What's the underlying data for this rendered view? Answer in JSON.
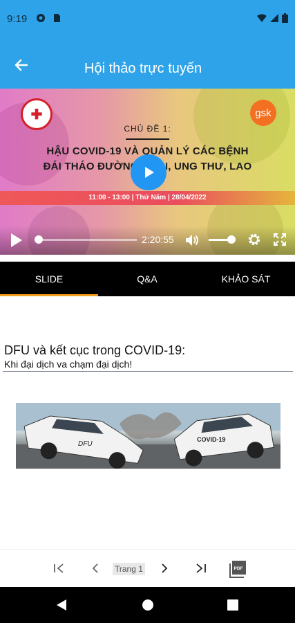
{
  "status_bar": {
    "time": "9:19",
    "icons": [
      "data-saver-icon",
      "sim-card-icon",
      "wifi-icon",
      "signal-icon",
      "battery-icon"
    ]
  },
  "app_bar": {
    "title": "Hội thảo trực tuyến",
    "back_icon": "arrow-back-icon"
  },
  "video": {
    "topic_label": "CHỦ ĐỀ 1:",
    "headline_line1": "HẬU COVID-19 VÀ QUẢN LÝ CÁC BỆNH",
    "headline_line2": "ĐÁI THÁO ĐƯỜNG, GAN, UNG THƯ, LAO",
    "schedule": "11:00 - 13:00 | Thứ Năm | 28/04/2022",
    "sponsor_logo_text": "gsk",
    "elapsed_time": "2:20:55",
    "progress": 0.02,
    "volume": 0.85,
    "colors": {
      "play_button": "#2196f3",
      "accent_strip": "#ef5858"
    }
  },
  "tabs": [
    {
      "label": "SLIDE",
      "active": true
    },
    {
      "label": "Q&A",
      "active": false
    },
    {
      "label": "KHẢO SÁT",
      "active": false
    }
  ],
  "slide": {
    "title": "DFU và kết cục trong COVID-19:",
    "subtitle": "Khi đại dịch va chạm đại dịch!",
    "image_car_left_text": "DFU",
    "image_car_right_text": "COVID-19"
  },
  "pager": {
    "page_label": "Trang 1",
    "pdf_icon_text": "PDF"
  },
  "colors": {
    "primary": "#2ea3ea",
    "tab_indicator": "#f59c1a",
    "tab_bar": "#000000"
  }
}
